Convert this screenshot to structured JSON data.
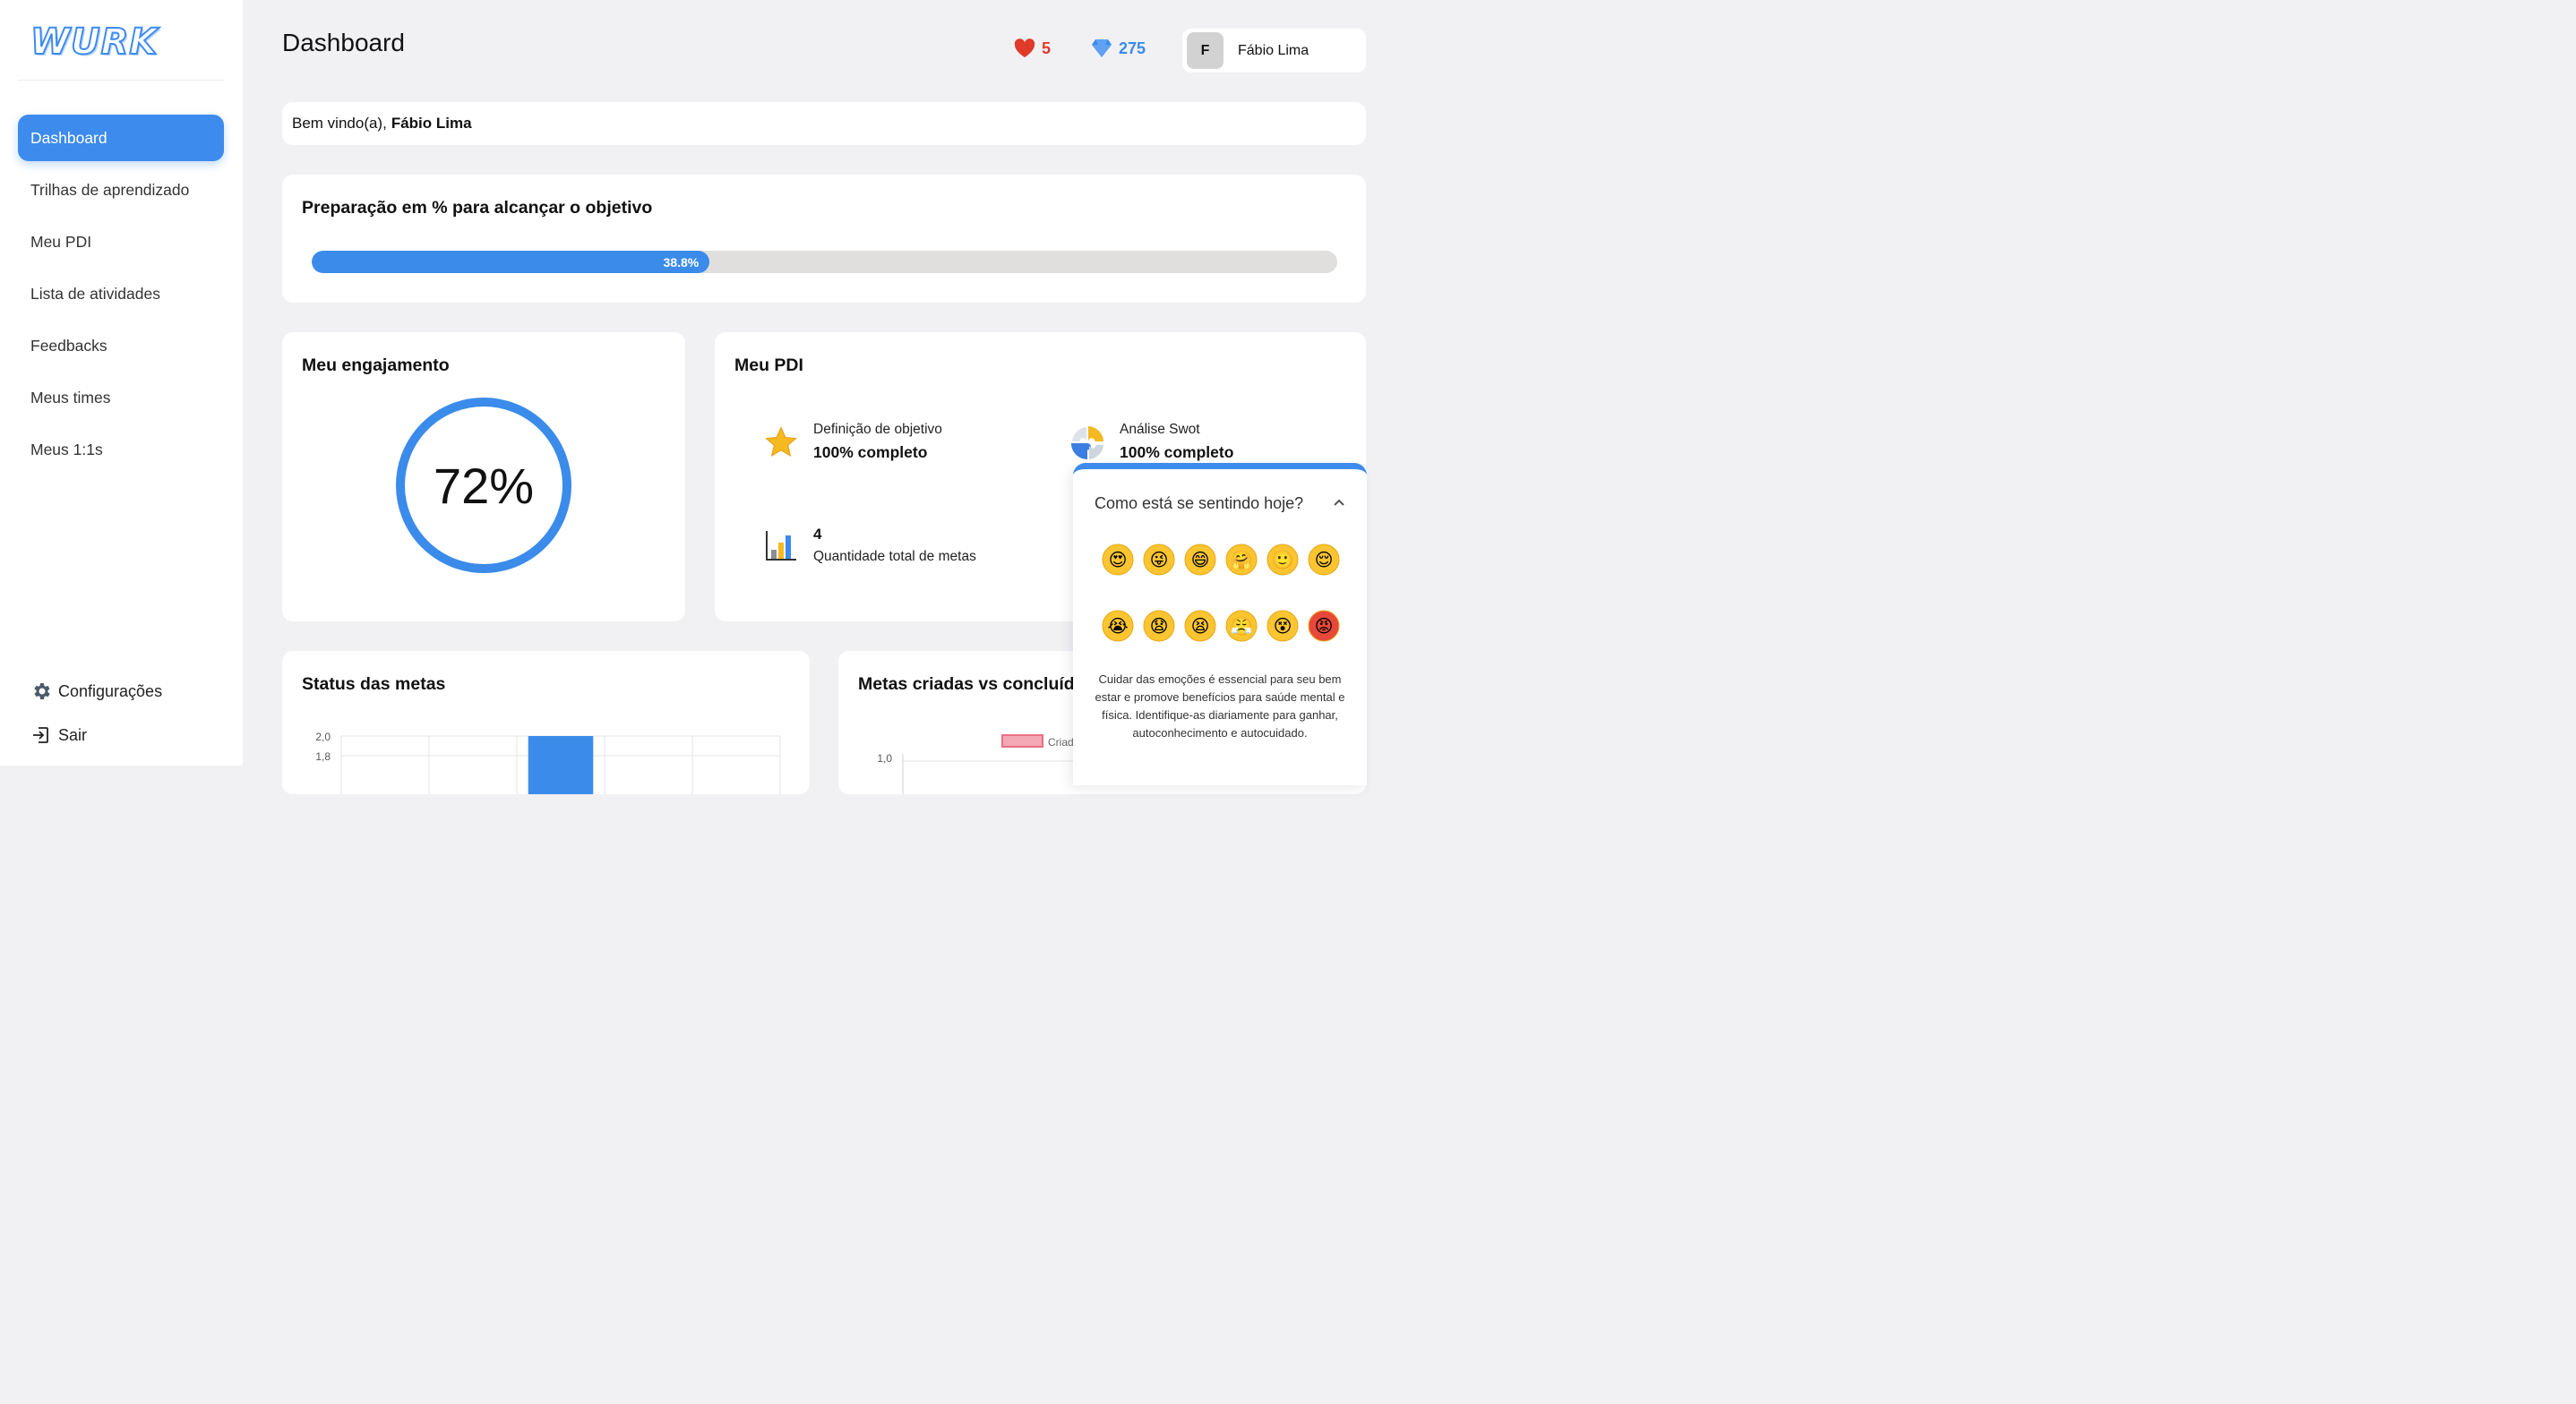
{
  "app": {
    "logo": "WURK",
    "page_title": "Dashboard"
  },
  "sidebar": {
    "items": [
      {
        "label": "Dashboard",
        "active": true
      },
      {
        "label": "Trilhas de aprendizado"
      },
      {
        "label": "Meu PDI"
      },
      {
        "label": "Lista de atividades"
      },
      {
        "label": "Feedbacks"
      },
      {
        "label": "Meus times"
      },
      {
        "label": "Meus 1:1s"
      }
    ],
    "settings_label": "Configurações",
    "logout_label": "Sair"
  },
  "header": {
    "hearts": "5",
    "gems": "275",
    "user_initial": "F",
    "user_name": "Fábio Lima",
    "colors": {
      "heart": "#e03a2b",
      "gem": "#3b8bea"
    }
  },
  "welcome": {
    "prefix": "Bem vindo(a),",
    "name": "Fábio Lima"
  },
  "preparation": {
    "title": "Preparação em % para alcançar o objetivo",
    "percent": 38.8,
    "label": "38.8%"
  },
  "engagement": {
    "title": "Meu engajamento",
    "percent": 72,
    "label": "72%"
  },
  "pdi": {
    "title": "Meu PDI",
    "objective": {
      "label": "Definição de objetivo",
      "status": "100% completo",
      "icon": "star-icon"
    },
    "swot": {
      "label": "Análise Swot",
      "status": "100% completo",
      "icon": "puzzle-icon"
    },
    "goals": {
      "count": "4",
      "label": "Quantidade total de metas",
      "icon": "bar-chart-icon"
    }
  },
  "status_card": {
    "title": "Status das metas",
    "chart_data": {
      "type": "bar",
      "y_ticks": [
        "2,0",
        "1,8"
      ],
      "ylim": [
        0,
        2
      ],
      "values": [
        0,
        0,
        2,
        0,
        0
      ],
      "color": "#3b8bea"
    }
  },
  "metas_card": {
    "title": "Metas criadas vs concluídas",
    "chart_data": {
      "type": "bar",
      "y_ticks": [
        "1,0"
      ],
      "legend": [
        "Criadas"
      ],
      "legend_color": "#f4a7b4"
    }
  },
  "mood": {
    "title": "Como está se sentindo hoje?",
    "row1": [
      "😍",
      "😜",
      "😄",
      "🤗",
      "🙂",
      "😌"
    ],
    "row2": [
      "😭",
      "😧",
      "😫",
      "😤",
      "😵",
      "😡"
    ],
    "text": "Cuidar das emoções é essencial para seu bem estar e promove benefícios para saúde mental e física. Identifique-as diariamente para ganhar, autoconhecimento e autocuidado."
  }
}
